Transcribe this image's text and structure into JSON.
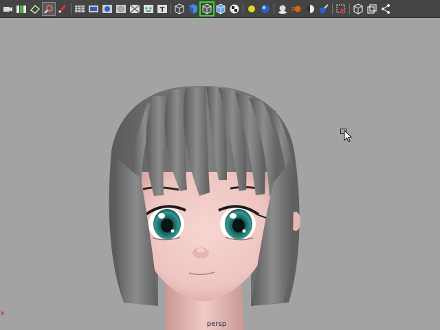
{
  "toolbar": {
    "icons": [
      "camera-attributes-icon",
      "bookmark-icon",
      "image-plane-icon",
      "2d-pan-zoom-icon",
      "grease-pencil-icon",
      "grid-icon",
      "film-gate-icon",
      "resolution-gate-icon",
      "gate-mask-icon",
      "field-chart-icon",
      "safe-action-icon",
      "safe-title-icon",
      "wireframe-icon",
      "smooth-shade-icon",
      "wireframe-on-shaded-icon",
      "flat-shade-icon",
      "textured-icon",
      "use-all-lights-icon",
      "shadows-icon",
      "screen-space-ao-icon",
      "motion-blur-icon",
      "anti-aliasing-icon",
      "isolate-select-icon",
      "xray-icon",
      "xray-joints-icon",
      "xray-components-icon"
    ],
    "active_icon": "wireframe-on-shaded-icon"
  },
  "viewport": {
    "camera_label": "persp",
    "axis_label": "x",
    "background_color": "#a3a3a3"
  },
  "colors": {
    "toolbar_bg": "#444444",
    "hair": "#7d7d7d",
    "skin": "#f0c8c4",
    "iris": "#2c8a84",
    "camera_label": "#16205a",
    "axis_x": "#c01010"
  }
}
